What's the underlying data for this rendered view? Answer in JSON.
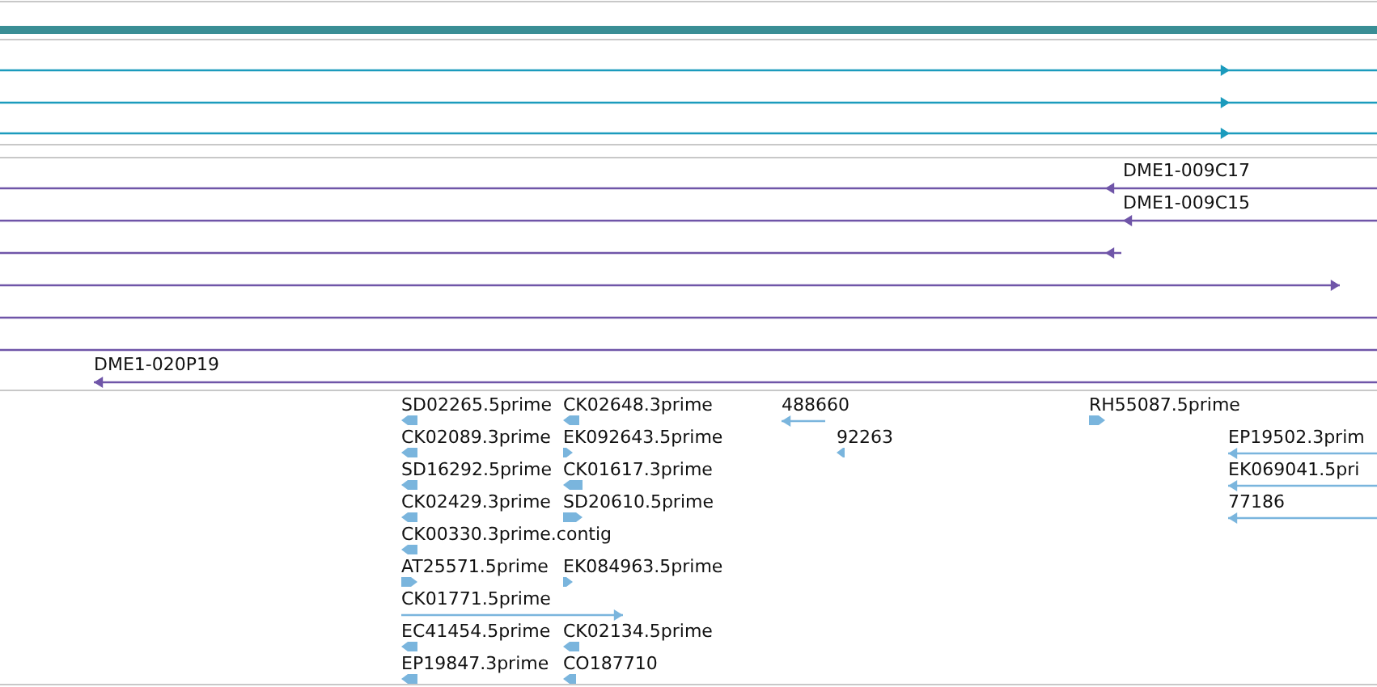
{
  "tracks": [
    {
      "kind": "lines",
      "features": [
        {
          "kind": "arrow",
          "forward": true
        },
        {
          "kind": "arrow",
          "forward": true
        },
        {
          "kind": "arrow",
          "forward": true
        }
      ]
    },
    {
      "kind": "lines",
      "features": [
        {
          "kind": "arrow",
          "label": "DME1-009C17",
          "forward": false
        },
        {
          "kind": "arrow",
          "label": "DME1-009C15",
          "forward": false
        },
        {
          "kind": "arrow",
          "forward": false
        },
        {
          "kind": "arrow",
          "forward": true
        },
        {
          "kind": "plain"
        },
        {
          "kind": "plain"
        },
        {
          "kind": "arrow",
          "label": "DME1-020P19",
          "forward": false
        }
      ]
    },
    {
      "kind": "blocks",
      "features": [
        {
          "kind": "arrow",
          "label": "SD02265.5prime",
          "forward": false
        },
        {
          "kind": "arrow",
          "label": "CK02648.3prime",
          "forward": false
        },
        {
          "kind": "arrow",
          "label": "488660",
          "forward": false
        },
        {
          "kind": "arrow",
          "label": "RH55087.5prime",
          "forward": true
        },
        {
          "kind": "arrow",
          "label": "CK02089.3prime",
          "forward": false
        },
        {
          "kind": "arrow",
          "label": "EK092643.5prime",
          "forward": true
        },
        {
          "kind": "arrow",
          "label": "92263",
          "forward": false
        },
        {
          "kind": "arrow",
          "label": "EP19502.3prim",
          "forward": false
        },
        {
          "kind": "arrow",
          "label": "SD16292.5prime",
          "forward": false
        },
        {
          "kind": "arrow",
          "label": "CK01617.3prime",
          "forward": false
        },
        {
          "kind": "arrow",
          "label": "EK069041.5pri",
          "forward": false
        },
        {
          "kind": "arrow",
          "label": "CK02429.3prime",
          "forward": false
        },
        {
          "kind": "arrow",
          "label": "SD20610.5prime",
          "forward": true
        },
        {
          "kind": "arrow",
          "label": "77186",
          "forward": false
        },
        {
          "kind": "arrow",
          "label": "CK00330.3prime.contig",
          "forward": false
        },
        {
          "kind": "arrow",
          "label": "AT25571.5prime",
          "forward": true
        },
        {
          "kind": "arrow",
          "label": "EK084963.5prime",
          "forward": true
        },
        {
          "kind": "arrow",
          "label": "CK01771.5prime",
          "forward": true
        },
        {
          "kind": "arrow",
          "label": "EC41454.5prime",
          "forward": false
        },
        {
          "kind": "arrow",
          "label": "CK02134.5prime",
          "forward": false
        },
        {
          "kind": "arrow",
          "label": "EP19847.3prime",
          "forward": false
        },
        {
          "kind": "arrow",
          "label": "CO187710",
          "forward": false
        }
      ]
    }
  ]
}
